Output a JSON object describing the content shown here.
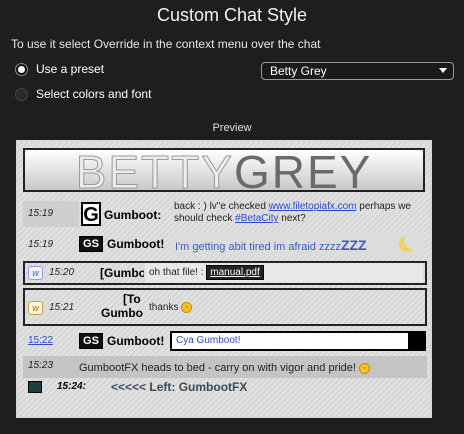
{
  "header": {
    "title": "Custom Chat Style",
    "subtitle": "To use it select Override in the context menu over the chat"
  },
  "options": {
    "preset_label": "Use a preset",
    "custom_label": "Select colors and font",
    "selected": "preset"
  },
  "preset_select": {
    "value": "Betty Grey"
  },
  "preview": {
    "label": "Preview",
    "banner_left": "BETTY",
    "banner_right": "GREY",
    "rows": [
      {
        "time": "15:19",
        "user": "Gumboot:",
        "msg_pre": "back : ) lv\"e checked ",
        "link1": "www.filetopiafx.com",
        "msg_mid": " perhaps we should check ",
        "link2": "#BetaCity",
        "msg_post": " next?"
      },
      {
        "time": "15:19",
        "user": "Gumboot!",
        "msg": "I'm getting abit tired im afraid zzzz",
        "zz": "ZZZ"
      },
      {
        "time": "15:20",
        "user": "[Gumbo",
        "msg": "oh that file! : ",
        "file": "manual.pdf"
      },
      {
        "time": "15:21",
        "user1": "[To",
        "user2": "Gumbo",
        "msg": "thanks"
      },
      {
        "time": "15:22",
        "user": "Gumboot!",
        "msg": "Cya Gumboot!"
      },
      {
        "time": "15:23",
        "msg": "GumbootFX heads to bed - carry on with vigor and pride!"
      },
      {
        "time": "15:24:",
        "msg": "<<<<< Left: GumbootFX"
      }
    ]
  },
  "colors": {
    "link": "#2a4ad0",
    "background": "#1e1e1e"
  }
}
